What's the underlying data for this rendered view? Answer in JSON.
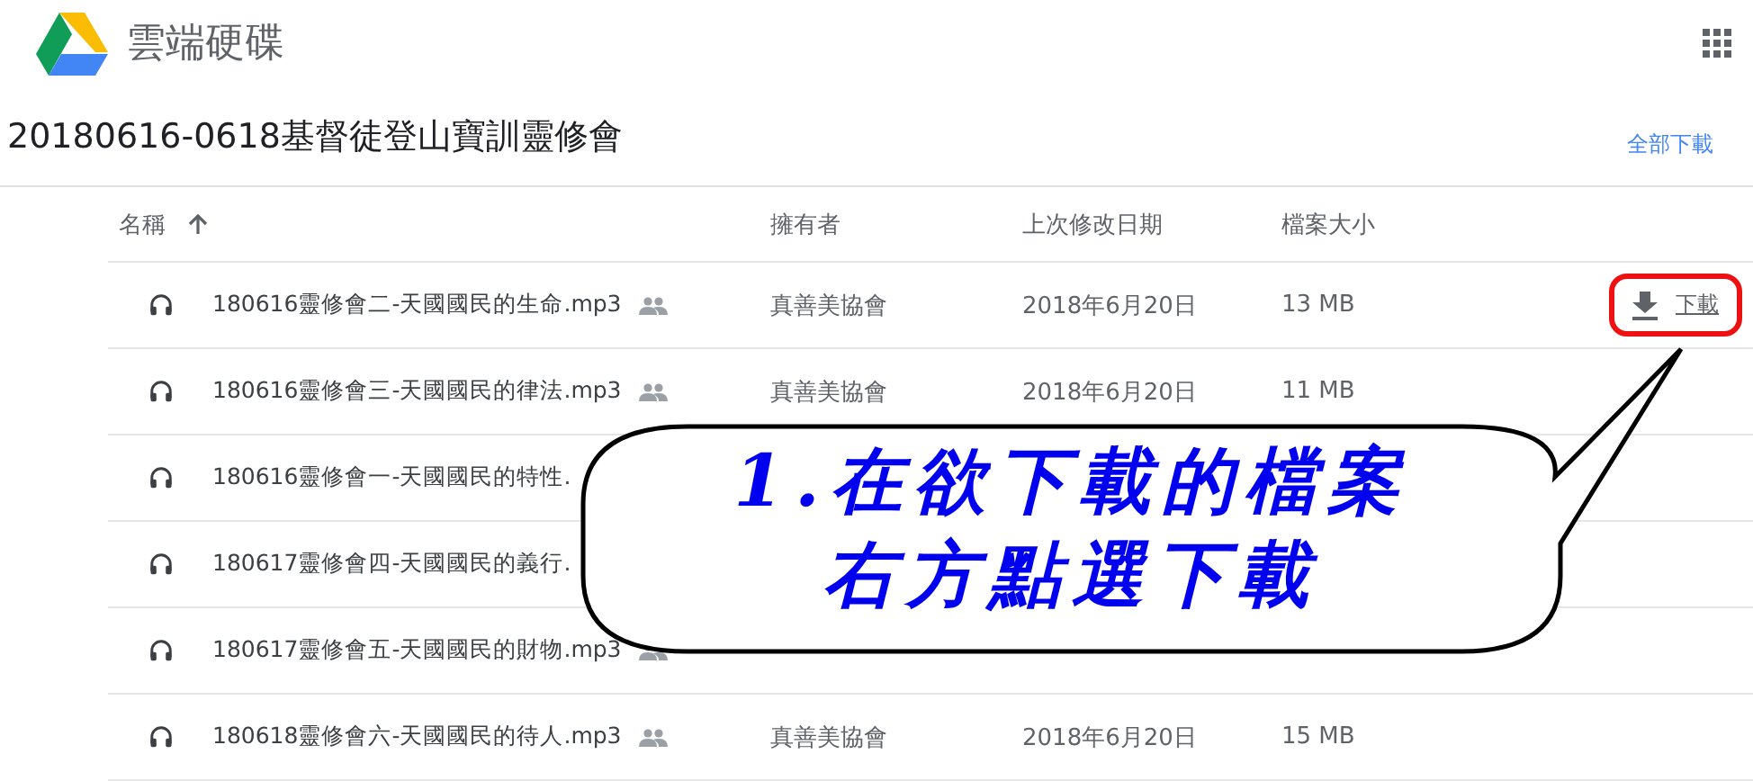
{
  "app": {
    "title": "雲端硬碟"
  },
  "folder": {
    "title": "20180616-0618基督徒登山寶訓靈修會",
    "download_all": "全部下載"
  },
  "table": {
    "columns": [
      {
        "label": "名稱",
        "sorted": true
      },
      {
        "label": "擁有者",
        "sorted": false
      },
      {
        "label": "上次修改日期",
        "sorted": false
      },
      {
        "label": "檔案大小",
        "sorted": false
      }
    ],
    "rows": [
      {
        "name": "180616靈修會二-天國國民的生命.mp3",
        "shared": true,
        "owner": "真善美協會",
        "modified": "2018年6月20日",
        "size": "13 MB",
        "action": "下載",
        "highlighted": true
      },
      {
        "name": "180616靈修會三-天國國民的律法.mp3",
        "shared": true,
        "owner": "真善美協會",
        "modified": "2018年6月20日",
        "size": "11 MB"
      },
      {
        "name": "180616靈修會一-天國國民的特性."
      },
      {
        "name": "180617靈修會四-天國國民的義行."
      },
      {
        "name": "180617靈修會五-天國國民的財物.mp3",
        "shared": true
      },
      {
        "name": "180618靈修會六-天國國民的待人.mp3",
        "shared": true,
        "owner": "真善美協會",
        "modified": "2018年6月20日",
        "size": "15 MB"
      }
    ]
  },
  "callout": {
    "lines": [
      "1.在欲下載的檔案",
      "右方點選下載"
    ]
  }
}
